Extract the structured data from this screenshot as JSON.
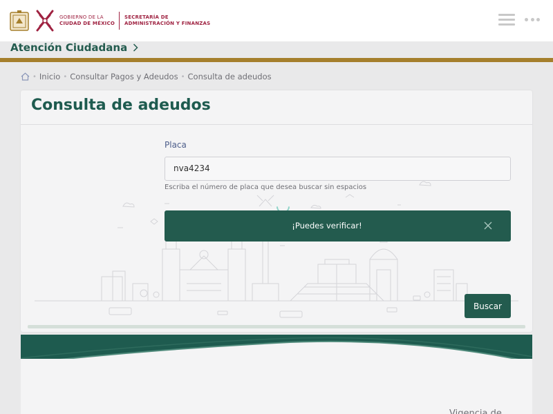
{
  "header": {
    "gov_line1": "GOBIERNO DE LA",
    "gov_line2": "CIUDAD DE MÉXICO",
    "secretaria_line1": "SECRETARÍA DE",
    "secretaria_line2": "ADMINISTRACIÓN Y FINANZAS",
    "brand_color": "#9f2241",
    "menu_icon": "hamburger-icon",
    "more_icon": "more-dots-icon"
  },
  "section": {
    "title": "Atención Ciudadana",
    "accent_color": "#a57f2c"
  },
  "breadcrumb": {
    "items": [
      "Inicio",
      "Consultar Pagos y Adeudos",
      "Consulta de adeudos"
    ]
  },
  "card": {
    "title": "Consulta de adeudos",
    "field_label": "Placa",
    "input_value": "nva4234",
    "helper_text": "Escriba el número de placa que desea buscar sin espacios",
    "alert_text": "¡Puedes verificar!",
    "search_button": "Buscar",
    "primary_color": "#235b4e"
  },
  "lower": {
    "partial_text": "Vigencia de"
  }
}
